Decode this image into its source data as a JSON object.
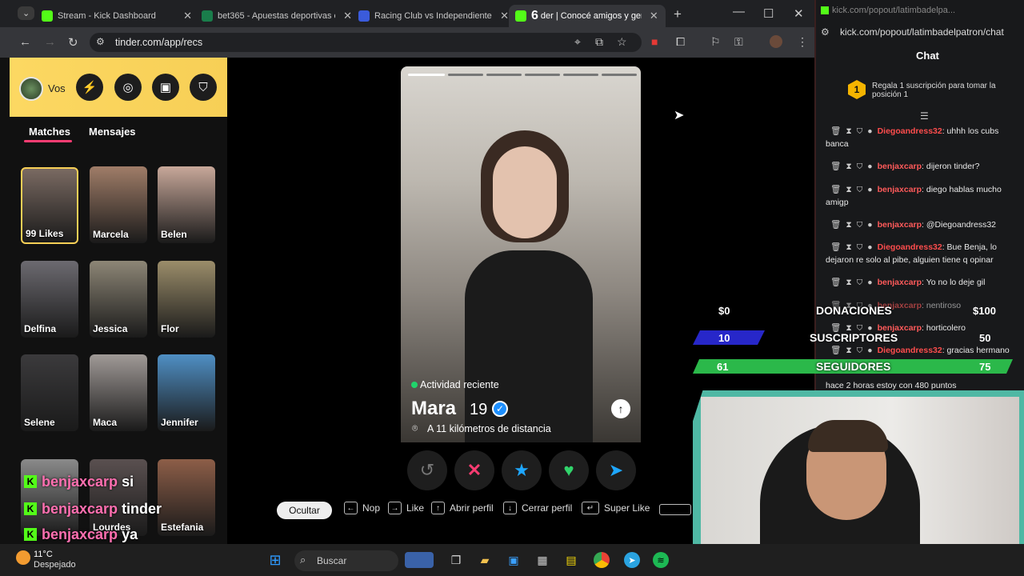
{
  "browser": {
    "tabs": [
      {
        "title": "Stream - Kick Dashboard",
        "color": "#53fc18"
      },
      {
        "title": "bet365 - Apuestas deportivas e",
        "color": "#1a7d4b"
      },
      {
        "title": "Racing Club vs Independiente |",
        "color": "#3b5bdb"
      },
      {
        "title": "der | Conocé amigos y gent",
        "color": "#53fc18"
      }
    ],
    "tab_number": "6",
    "url": "tinder.com/app/recs"
  },
  "tinder": {
    "user_label": "Vos",
    "tabs": {
      "matches": "Matches",
      "messages": "Mensajes"
    },
    "matches": [
      {
        "name": "99 Likes",
        "color": "#7a6a62"
      },
      {
        "name": "Marcela",
        "color": "#a07d68"
      },
      {
        "name": "Belen",
        "color": "#c8a89a"
      },
      {
        "name": "Delfina",
        "color": "#6c6a70"
      },
      {
        "name": "Jessica",
        "color": "#8d8676"
      },
      {
        "name": "Flor",
        "color": "#9b8d6a"
      },
      {
        "name": "Selene",
        "color": "#3b3a3c"
      },
      {
        "name": "Maca",
        "color": "#a09a97"
      },
      {
        "name": "Jennifer",
        "color": "#4f8fc4"
      },
      {
        "name": "",
        "color": "#8a8a8a"
      },
      {
        "name": "Lourdes",
        "color": "#5a5050"
      },
      {
        "name": "Estefania",
        "color": "#8d5e48"
      }
    ],
    "profile": {
      "status": "Actividad reciente",
      "name": "Mara",
      "age": "19",
      "distance": "A 11 kilómetros de distancia"
    },
    "hints": {
      "hide": "Ocultar",
      "nope": "Nop",
      "like": "Like",
      "open": "Abrir perfil",
      "close": "Cerrar perfil",
      "superlike": "Super Like"
    }
  },
  "popout": {
    "window_title": "kick.com/popout/latimbadelpa...",
    "url": "kick.com/popout/latimbadelpatron/chat",
    "chat_header": "Chat",
    "gift_rank": "1",
    "gift_text": "Regala 1 suscripción para tomar la posición 1",
    "messages": [
      {
        "user": "Diegoandress32",
        "text": ": uhhh los cubs banca"
      },
      {
        "user": "benjaxcarp",
        "text": ": dijeron tinder?"
      },
      {
        "user": "benjaxcarp",
        "text": ": diego hablas mucho amigp"
      },
      {
        "user": "benjaxcarp",
        "text": ": @Diegoandress32"
      },
      {
        "user": "Diegoandress32",
        "text": ": Bue Benja, lo dejaron re solo al pibe, alguien tiene q opinar"
      },
      {
        "user": "benjaxcarp",
        "text": ": Yo no lo deje gil"
      },
      {
        "user": "benjaxcarp",
        "text": ": nentiroso"
      },
      {
        "user": "benjaxcarp",
        "text": ": horticolero"
      },
      {
        "user": "Diegoandress32",
        "text": ": gracias hermano"
      },
      {
        "user": "",
        "text": "hace 2 horas estoy con 480 puntos"
      }
    ]
  },
  "overlay": {
    "donaciones": {
      "label": "DONACIONES",
      "current": "$0",
      "goal": "$100"
    },
    "suscriptores": {
      "label": "SUSCRIPTORES",
      "current": "10",
      "goal": "50",
      "fill": 0.2
    },
    "seguidores": {
      "label": "SEGUIDORES",
      "current": "61",
      "goal": "75",
      "fill": 0.81
    },
    "chat_lines": [
      {
        "user": "benjaxcarp",
        "text": "si"
      },
      {
        "user": "benjaxcarp",
        "text": "tinder"
      },
      {
        "user": "benjaxcarp",
        "text": "ya"
      }
    ]
  },
  "taskbar": {
    "temp": "11°C",
    "weather": "Despejado",
    "search_placeholder": "Buscar"
  }
}
